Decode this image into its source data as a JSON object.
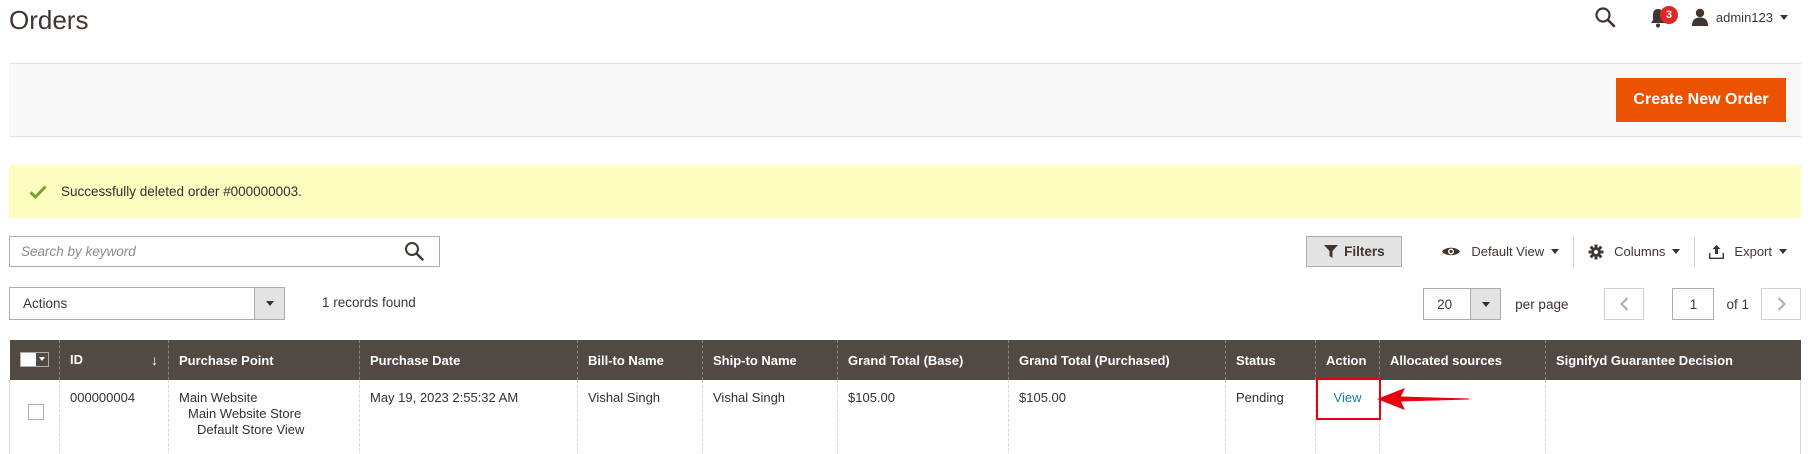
{
  "header": {
    "title": "Orders",
    "notifications_count": "3",
    "username": "admin123"
  },
  "action_bar": {
    "create_button": "Create New Order"
  },
  "message": {
    "text": "Successfully deleted order #000000003."
  },
  "search": {
    "placeholder": "Search by keyword"
  },
  "toolbar": {
    "filters": "Filters",
    "view": "Default View",
    "columns": "Columns",
    "export": "Export"
  },
  "mass_actions": {
    "label": "Actions",
    "records_found": "1 records found"
  },
  "pager": {
    "per_page_value": "20",
    "per_page_label": "per page",
    "current_page": "1",
    "of_total": "of 1"
  },
  "table": {
    "columns": [
      "ID",
      "Purchase Point",
      "Purchase Date",
      "Bill-to Name",
      "Ship-to Name",
      "Grand Total (Base)",
      "Grand Total (Purchased)",
      "Status",
      "Action",
      "Allocated sources",
      "Signifyd Guarantee Decision"
    ],
    "rows": [
      {
        "id": "000000004",
        "purchase_point": [
          "Main Website",
          "Main Website Store",
          "Default Store View"
        ],
        "purchase_date": "May 19, 2023 2:55:32 AM",
        "bill_to": "Vishal Singh",
        "ship_to": "Vishal Singh",
        "grand_total_base": "$105.00",
        "grand_total_purchased": "$105.00",
        "status": "Pending",
        "action": "View",
        "allocated_sources": "",
        "signifyd": ""
      }
    ]
  },
  "colors": {
    "accent": "#eb5202",
    "header_bg": "#514943",
    "message_bg": "#fdfdc0",
    "link": "#1979c3",
    "annotation": "#e8000f"
  }
}
